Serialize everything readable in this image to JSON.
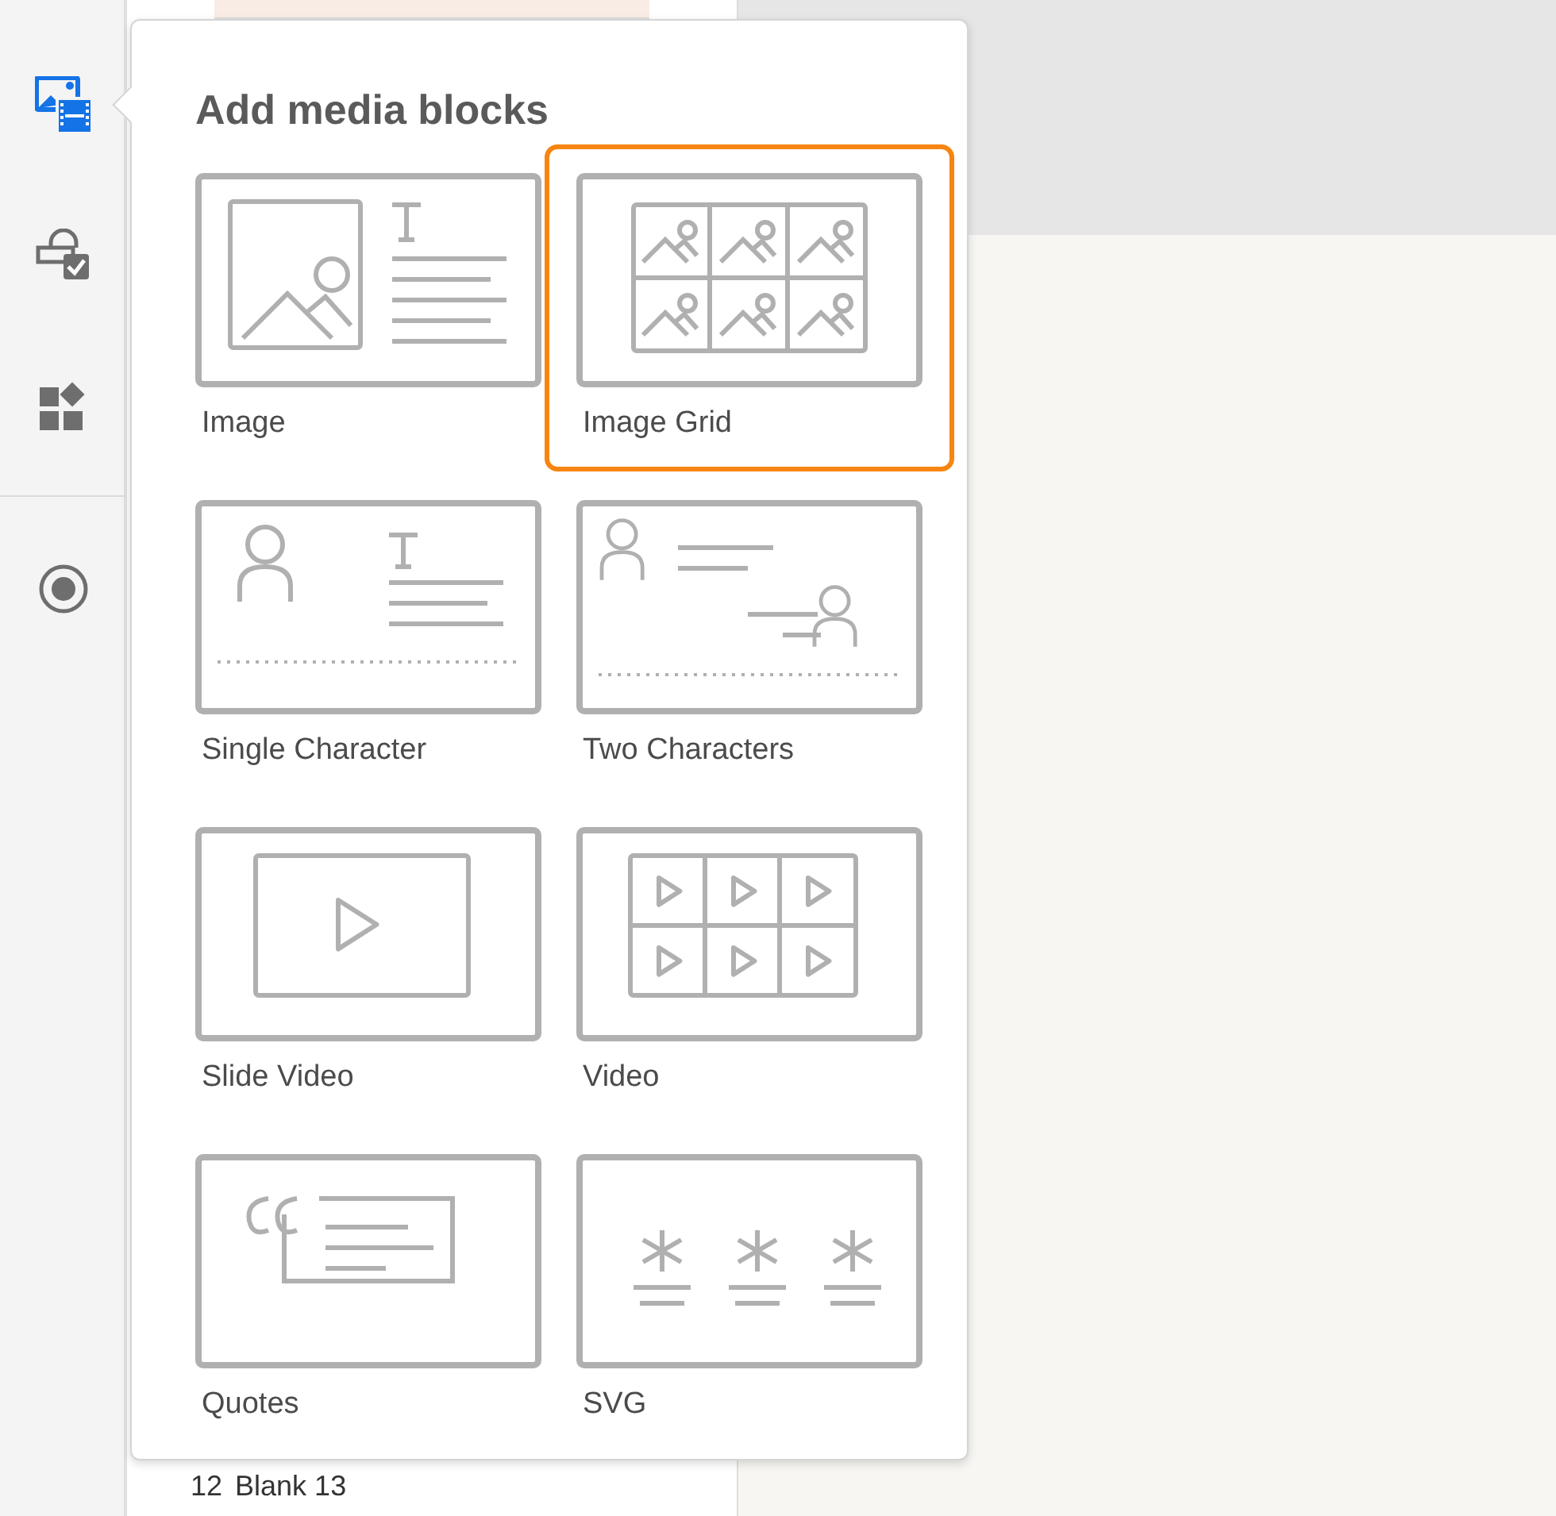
{
  "sidebar": {
    "items": [
      {
        "kind": "media",
        "selected": true
      },
      {
        "kind": "lock",
        "selected": false
      },
      {
        "kind": "widgets",
        "selected": false
      },
      {
        "kind": "record",
        "selected": false
      }
    ]
  },
  "popup": {
    "title": "Add media blocks",
    "tiles": [
      {
        "label": "Image",
        "kind": "image",
        "selected": false
      },
      {
        "label": "Image Grid",
        "kind": "image-grid",
        "selected": true
      },
      {
        "label": "Single Character",
        "kind": "single-character",
        "selected": false
      },
      {
        "label": "Two Characters",
        "kind": "two-characters",
        "selected": false
      },
      {
        "label": "Slide Video",
        "kind": "slide-video",
        "selected": false
      },
      {
        "label": "Video",
        "kind": "video",
        "selected": false
      },
      {
        "label": "Quotes",
        "kind": "quotes",
        "selected": false
      },
      {
        "label": "SVG",
        "kind": "svg",
        "selected": false
      }
    ]
  },
  "page_list": {
    "number": "12",
    "label": "Blank 13"
  }
}
